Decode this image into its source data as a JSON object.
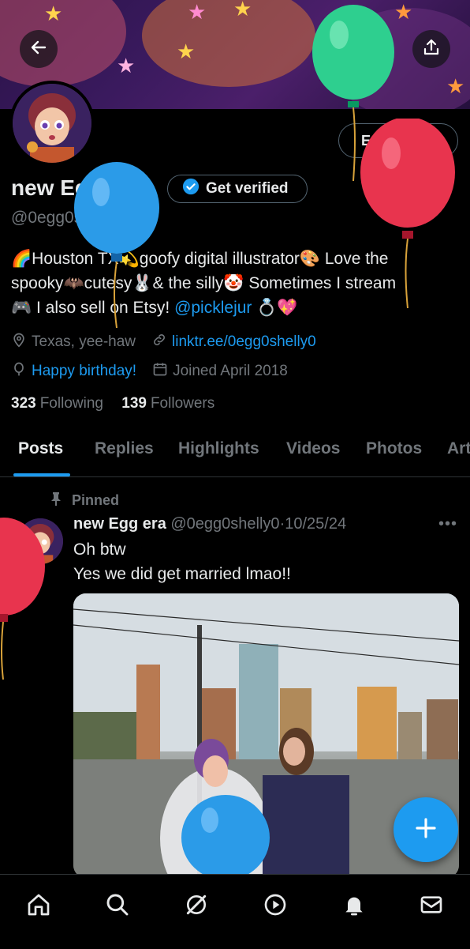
{
  "profile": {
    "name": "new Egg era",
    "handle": "@0egg0shelly0",
    "edit_profile_label": "Edit profile",
    "get_verified_label": "Get verified",
    "bio_line1": "🌈Houston TX💫goofy digital illustrator🎨 Love the",
    "bio_line2": "spooky🦇cutesy🐰& the silly🤡 Sometimes I stream",
    "bio_line3_prefix": "🎮 I also sell on Etsy! ",
    "bio_mention": "@picklejur",
    "bio_line3_suffix": " 💍💖",
    "location": "Texas, yee-haw",
    "website": "linktr.ee/0egg0shelly0",
    "birthday": "Happy birthday!",
    "joined": "Joined April 2018",
    "following_count": "323",
    "following_label": "Following",
    "followers_count": "139",
    "followers_label": "Followers"
  },
  "tabs": [
    "Posts",
    "Replies",
    "Highlights",
    "Videos",
    "Photos",
    "Art"
  ],
  "post": {
    "pinned_label": "Pinned",
    "author": "new Egg era",
    "handle": "@0egg0shelly0",
    "separator": "·",
    "date": "10/25/24",
    "more": "•••",
    "text_line1": "Oh btw",
    "text_line2": "Yes we did get married lmao!!"
  },
  "icons": {
    "back": "back-arrow-icon",
    "share": "share-icon",
    "verified": "verified-badge-icon",
    "location": "location-pin-icon",
    "link": "link-icon",
    "birthday": "balloon-icon",
    "calendar": "calendar-icon",
    "pin": "pin-icon",
    "compose": "plus-icon",
    "nav": [
      "home-icon",
      "search-icon",
      "grok-icon",
      "video-icon",
      "notifications-icon",
      "messages-icon"
    ]
  },
  "colors": {
    "accent": "#1d9bf0",
    "background": "#000000",
    "text": "#e7e9ea",
    "muted": "#71767b",
    "border": "#2f3336"
  }
}
